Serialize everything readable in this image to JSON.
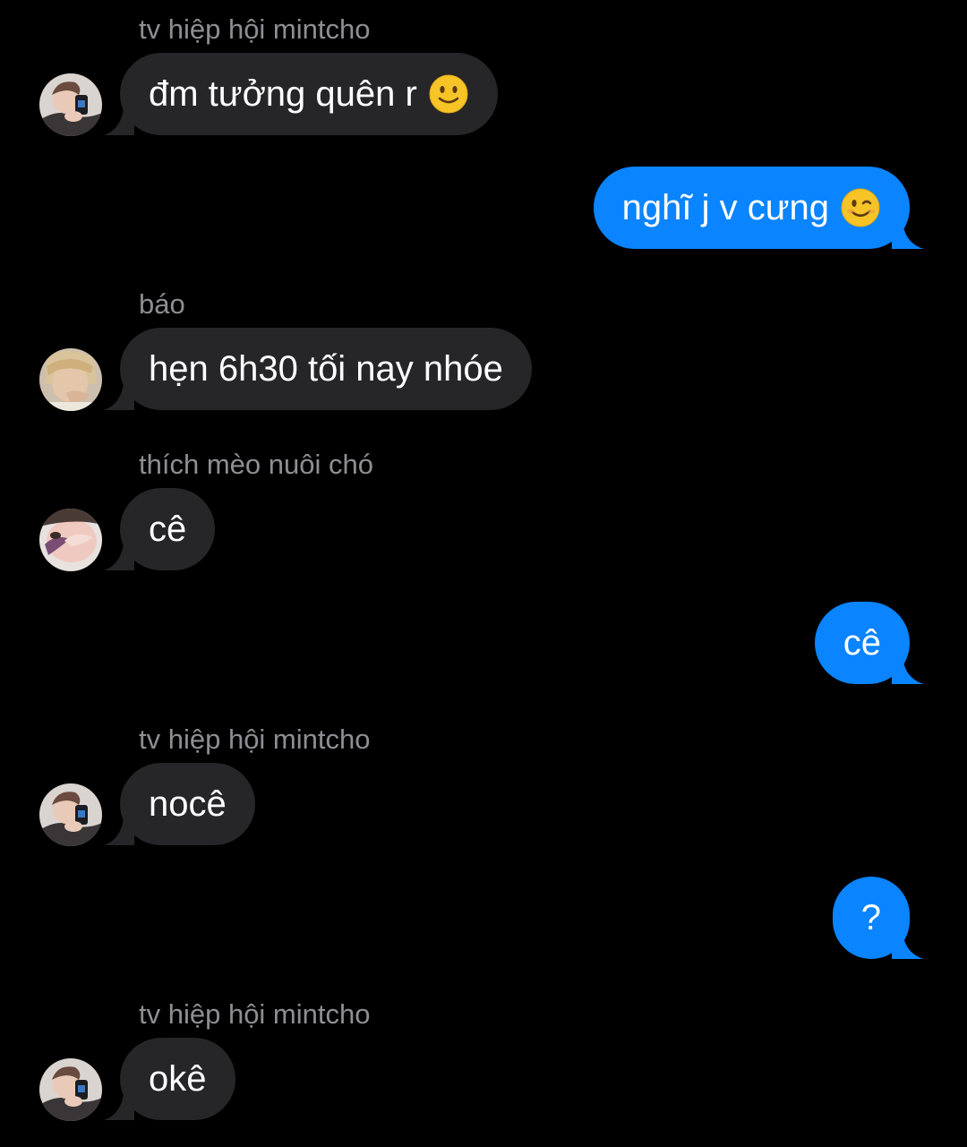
{
  "conversation": {
    "groups": [
      {
        "sender": "tv hiệp hội mintcho",
        "text": "đm tưởng quên r",
        "emoji": "slightly-smiling-face",
        "avatar": "avatar-mintcho"
      },
      {
        "text": "nghĩ j v cưng",
        "emoji": "winking-face"
      },
      {
        "sender": "báo",
        "text": "hẹn 6h30 tối nay nhóe",
        "avatar": "avatar-bao"
      },
      {
        "sender": "thích mèo nuôi chó",
        "text": "cê",
        "avatar": "avatar-meo"
      },
      {
        "text": "cê"
      },
      {
        "sender": "tv hiệp hội mintcho",
        "text": "nocê",
        "avatar": "avatar-mintcho"
      },
      {
        "text": "?"
      },
      {
        "sender": "tv hiệp hội mintcho",
        "text": "okê",
        "avatar": "avatar-mintcho"
      }
    ]
  },
  "colors": {
    "background": "#000000",
    "incoming_bubble": "#262628",
    "outgoing_bubble": "#0a84ff",
    "sender_name": "#8e8e93",
    "message_text": "#ffffff"
  }
}
